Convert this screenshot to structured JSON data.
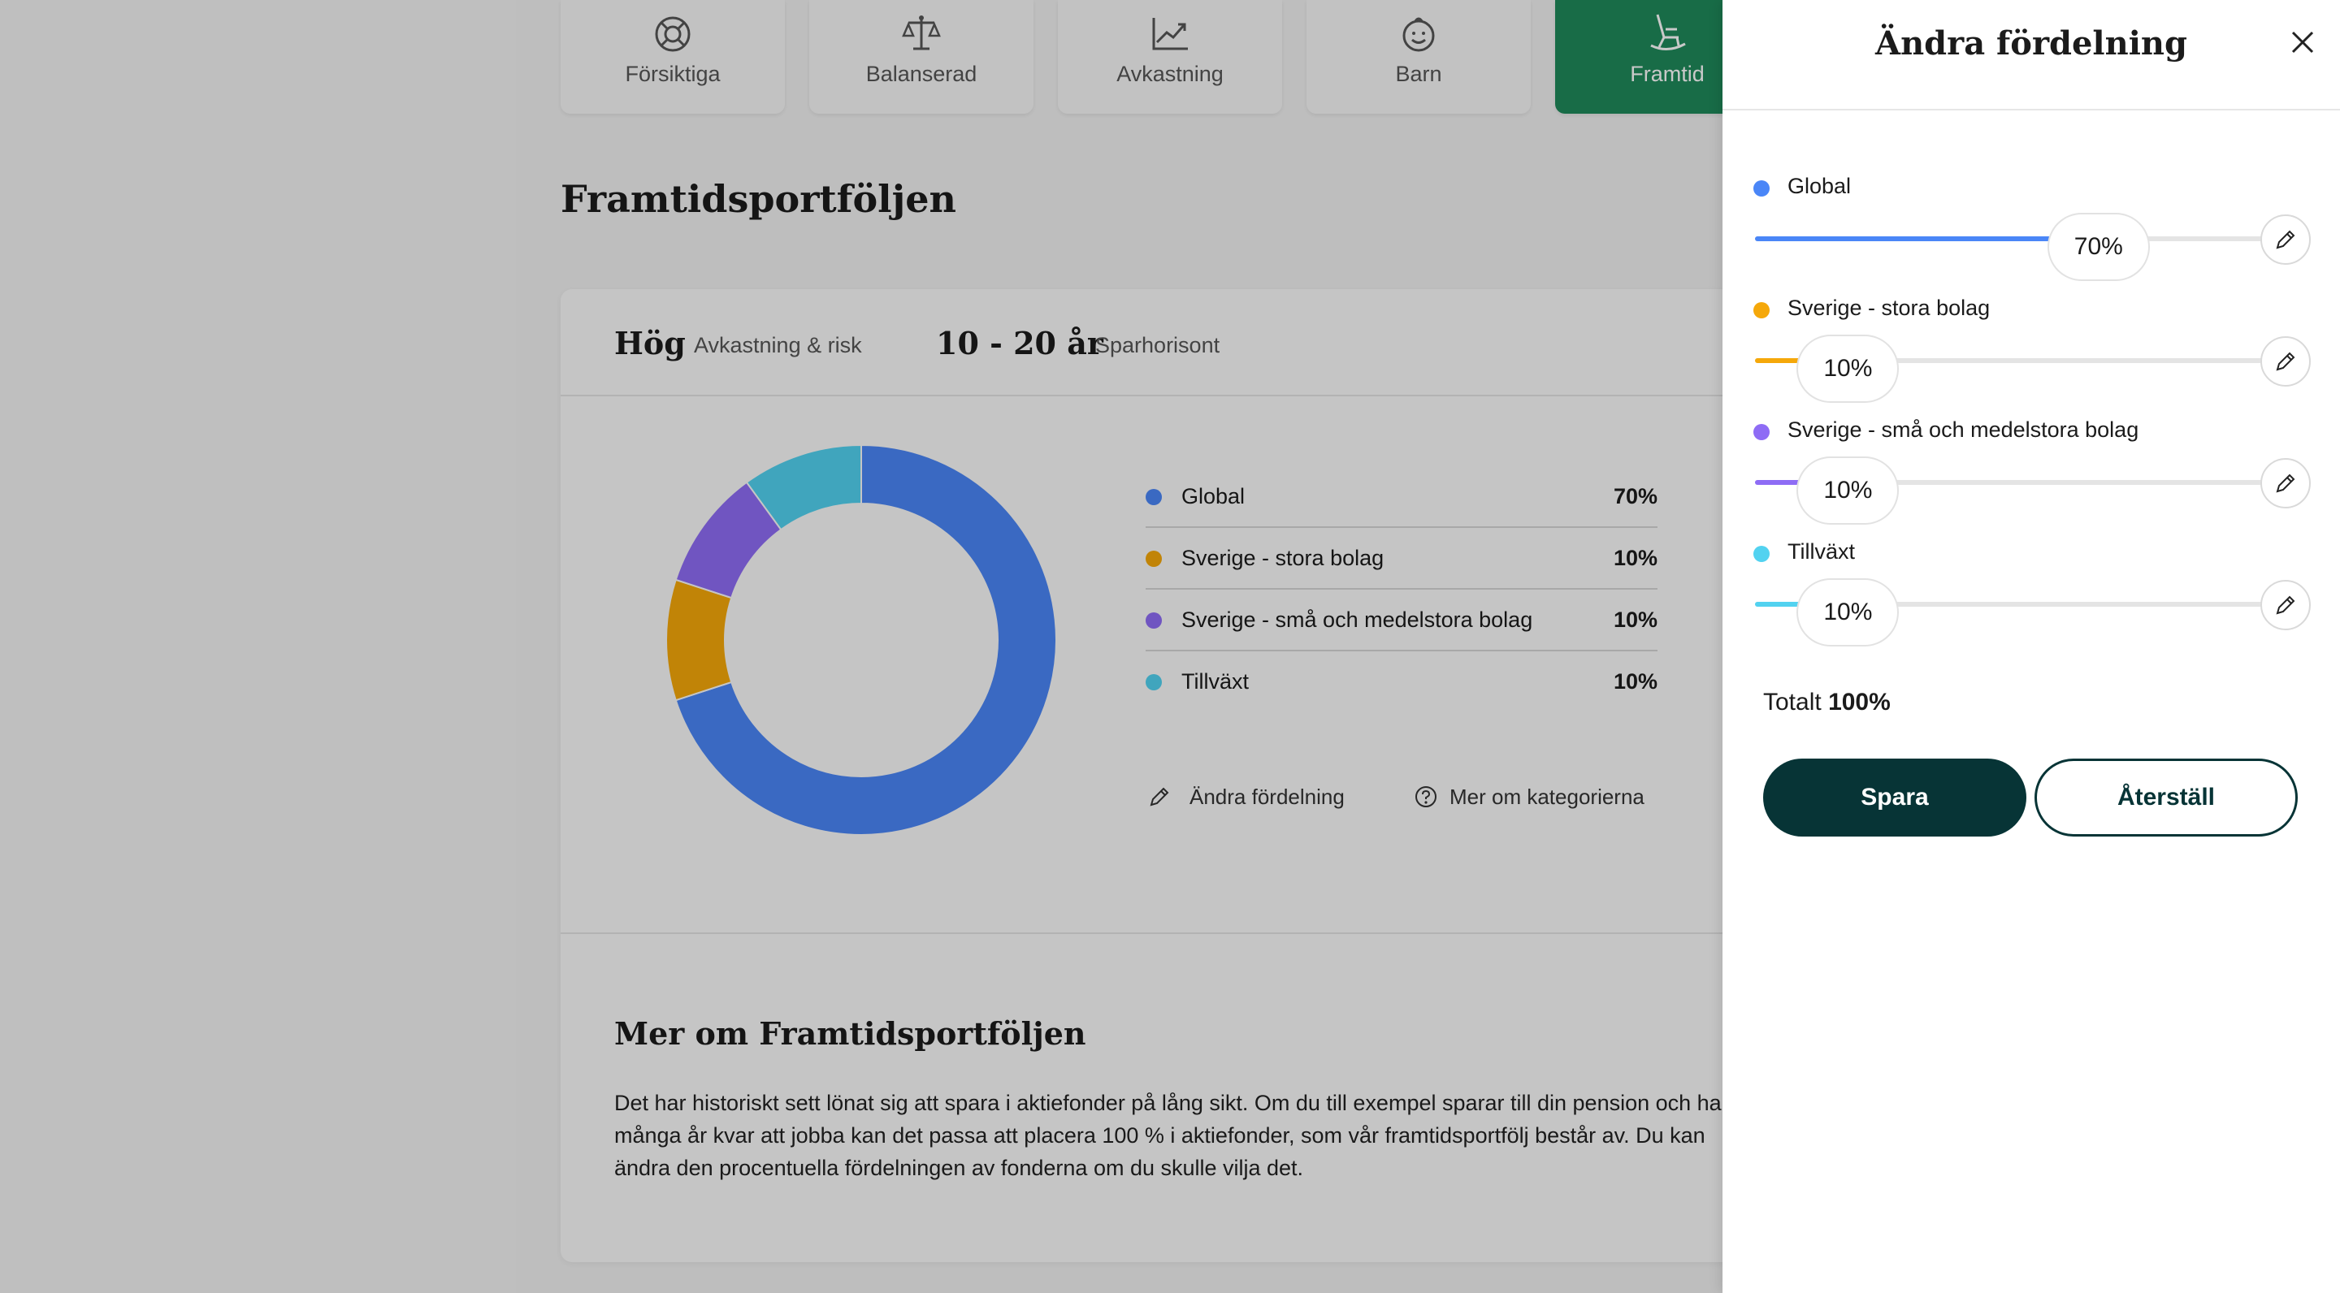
{
  "tabs": [
    {
      "label": "Försiktiga",
      "icon": "lifebuoy-icon",
      "active": false
    },
    {
      "label": "Balanserad",
      "icon": "scales-icon",
      "active": false
    },
    {
      "label": "Avkastning",
      "icon": "trend-chart-icon",
      "active": false
    },
    {
      "label": "Barn",
      "icon": "baby-face-icon",
      "active": false
    },
    {
      "label": "Framtid",
      "icon": "rocking-chair-icon",
      "active": true
    }
  ],
  "page": {
    "title": "Framtidsportföljen"
  },
  "card": {
    "risk_value": "Hög",
    "risk_label": "Avkastning & risk",
    "horizon_value": "10 - 20 år",
    "horizon_label": "Sparhorisont",
    "links": {
      "edit_label": "Ändra fördelning",
      "more_label": "Mer om kategorierna"
    },
    "more_title": "Mer om Framtidsportföljen",
    "more_text": "Det har historiskt sett lönat sig att spara i aktiefonder på lång sikt. Om du till exempel sparar till din pension och har många år kvar att jobba kan det passa att placera 100 % i aktiefonder, som vår framtidsportfölj består av.  Du kan ändra den procentuella fördelningen av fonderna om du skulle vilja det."
  },
  "chart_data": {
    "type": "pie",
    "donut": true,
    "categories": [
      "Global",
      "Sverige - stora bolag",
      "Sverige - små och medelstora bolag",
      "Tillväxt"
    ],
    "values": [
      70,
      10,
      10,
      10
    ],
    "labels": [
      "70%",
      "10%",
      "10%",
      "10%"
    ],
    "colors": [
      "#4a86f7",
      "#f5a80a",
      "#8e6cf5",
      "#52d2f0"
    ]
  },
  "drawer": {
    "title": "Ändra fördelning",
    "allocations": [
      {
        "name": "Global",
        "value": 70,
        "display": "70%",
        "color": "#4a86f7"
      },
      {
        "name": "Sverige - stora bolag",
        "value": 10,
        "display": "10%",
        "color": "#f5a80a"
      },
      {
        "name": "Sverige - små och medelstora bolag",
        "value": 10,
        "display": "10%",
        "color": "#8e6cf5"
      },
      {
        "name": "Tillväxt",
        "value": 10,
        "display": "10%",
        "color": "#52d2f0"
      }
    ],
    "total_label": "Totalt",
    "total_value": "100%",
    "save_label": "Spara",
    "reset_label": "Återställ"
  }
}
